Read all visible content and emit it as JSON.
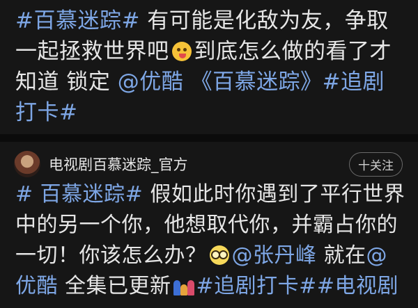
{
  "post_top": {
    "tag_show": "#百慕迷踪#",
    "text_1": " 有可能是化敌为友，争取一起拯救世界吧",
    "emoji_1": "yum-face-emoji",
    "text_2": "到底怎么做的看了才知道 锁定 ",
    "mention_platform": "@优酷",
    "text_3": " ",
    "title_link": "《百慕迷踪》",
    "tag_checkin": "#追剧打卡#"
  },
  "author": {
    "name": "电视剧百慕迷踪_官方",
    "follow_label": "十关注"
  },
  "post_bottom": {
    "tag_show": "# 百慕迷踪#",
    "text_1": " 假如此时你遇到了平行世界中的另一个你，他想取代你，并霸占你的一切！你该怎么办？",
    "emoji_1": "glasses-face-emoji",
    "mention_actor": "@张丹峰",
    "text_2": " 就在",
    "mention_platform": "@优酷",
    "text_3": " 全集已更新",
    "emoji_2": "family-emoji",
    "tag_checkin": "#追剧打卡#",
    "tag_tv": "#电视剧"
  },
  "colors": {
    "background": "#161616",
    "text": "#e6e6e6",
    "link": "#7ea7e6",
    "divider": "#0b0b0b"
  }
}
